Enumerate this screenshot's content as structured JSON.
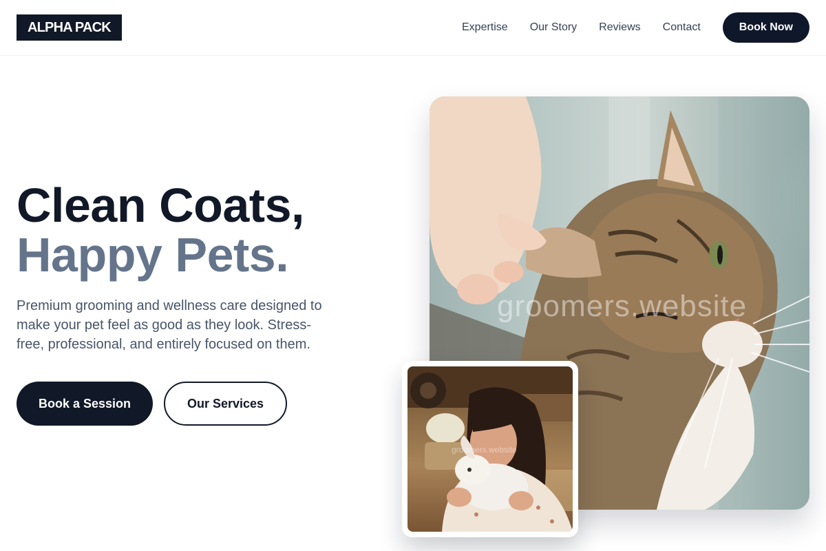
{
  "header": {
    "logo": "ALPHA PACK",
    "nav": [
      {
        "label": "Expertise"
      },
      {
        "label": "Our Story"
      },
      {
        "label": "Reviews"
      },
      {
        "label": "Contact"
      }
    ],
    "cta_label": "Book Now"
  },
  "hero": {
    "headline_line1": "Clean Coats,",
    "headline_line2": "Happy Pets.",
    "subtext": "Premium grooming and wellness care designed to make your pet feel as good as they look. Stress-free, professional, and entirely focused on them.",
    "primary_button": "Book a Session",
    "secondary_button": "Our Services"
  },
  "images": {
    "main_watermark": "groomers.website",
    "secondary_watermark": "groomers.website",
    "main_subject": "tabby cat with hand touching ear",
    "secondary_subject": "woman holding white rabbit"
  },
  "colors": {
    "primary": "#111827",
    "muted_heading": "#64748b",
    "body_text": "#475569"
  }
}
